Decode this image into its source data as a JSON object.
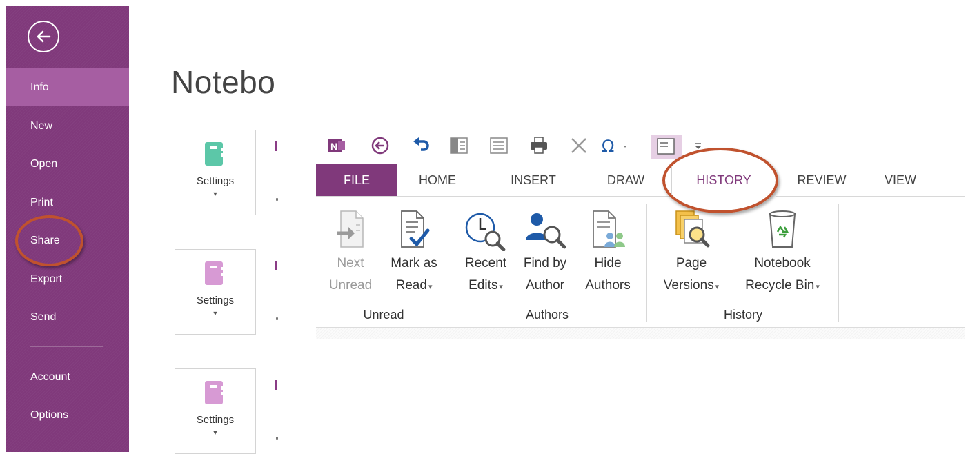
{
  "sidebar": {
    "items": [
      {
        "label": "Info"
      },
      {
        "label": "New"
      },
      {
        "label": "Open"
      },
      {
        "label": "Print"
      },
      {
        "label": "Share"
      },
      {
        "label": "Export"
      },
      {
        "label": "Send"
      },
      {
        "label": "Account"
      },
      {
        "label": "Options"
      }
    ],
    "selected": "Info",
    "colors": {
      "background": "#80397b",
      "selected": "#a65ea2"
    }
  },
  "main": {
    "title": "Notebo",
    "notebooks": [
      {
        "settings_label": "Settings",
        "icon_color": "#5cc7a8"
      },
      {
        "settings_label": "Settings",
        "icon_color": "#d79ad4"
      },
      {
        "settings_label": "Settings",
        "icon_color": "#d79ad4"
      }
    ]
  },
  "ribbon": {
    "quick_access": [
      "onenote-icon",
      "back-icon",
      "undo-icon",
      "dock-icon",
      "full-page-icon",
      "print-icon",
      "delete-icon",
      "symbol-icon",
      "normal-view-icon",
      "customize-icon"
    ],
    "tabs": [
      {
        "label": "FILE"
      },
      {
        "label": "HOME"
      },
      {
        "label": "INSERT"
      },
      {
        "label": "DRAW"
      },
      {
        "label": "HISTORY"
      },
      {
        "label": "REVIEW"
      },
      {
        "label": "VIEW"
      }
    ],
    "active_tab": "HISTORY",
    "groups": [
      {
        "label": "Unread",
        "buttons": [
          {
            "line1": "Next",
            "line2": "Unread",
            "enabled": false
          },
          {
            "line1": "Mark as",
            "line2": "Read",
            "dropdown": true
          }
        ]
      },
      {
        "label": "Authors",
        "buttons": [
          {
            "line1": "Recent",
            "line2": "Edits",
            "dropdown": true
          },
          {
            "line1": "Find by",
            "line2": "Author"
          },
          {
            "line1": "Hide",
            "line2": "Authors"
          }
        ]
      },
      {
        "label": "History",
        "buttons": [
          {
            "line1": "Page",
            "line2": "Versions",
            "dropdown": true
          },
          {
            "line1": "Notebook",
            "line2": "Recycle Bin",
            "dropdown": true
          }
        ]
      }
    ],
    "colors": {
      "accent": "#80397b",
      "annotation": "#c0522e"
    }
  }
}
